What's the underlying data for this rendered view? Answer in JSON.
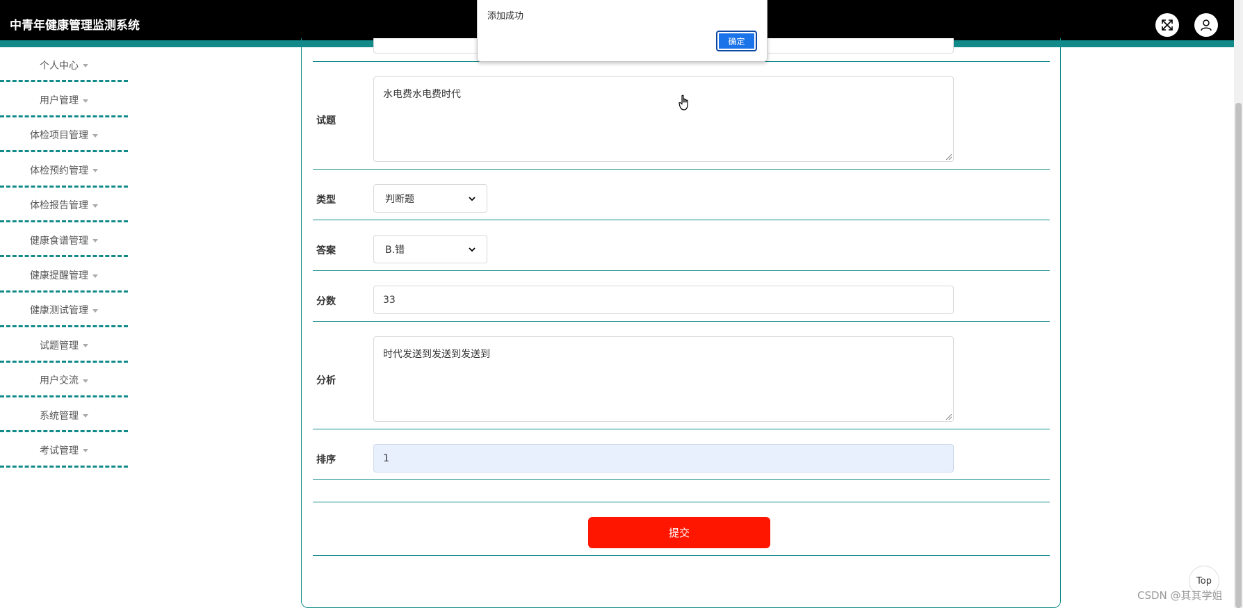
{
  "header": {
    "title": "中青年健康管理监测系统"
  },
  "sidebar": {
    "items": [
      {
        "label": "个人中心"
      },
      {
        "label": "用户管理"
      },
      {
        "label": "体检项目管理"
      },
      {
        "label": "体检预约管理"
      },
      {
        "label": "体检报告管理"
      },
      {
        "label": "健康食谱管理"
      },
      {
        "label": "健康提醒管理"
      },
      {
        "label": "健康测试管理"
      },
      {
        "label": "试题管理"
      },
      {
        "label": "用户交流"
      },
      {
        "label": "系统管理"
      },
      {
        "label": "考试管理"
      }
    ]
  },
  "form": {
    "question": {
      "label": "试题",
      "value": "水电费水电费时代"
    },
    "type": {
      "label": "类型",
      "value": "判断题"
    },
    "answer": {
      "label": "答案",
      "value": "B.错"
    },
    "score": {
      "label": "分数",
      "value": "33"
    },
    "analysis": {
      "label": "分析",
      "value": "时代发送到发送到发送到"
    },
    "order": {
      "label": "排序",
      "value": "1"
    },
    "submit_label": "提交"
  },
  "dialog": {
    "message": "添加成功",
    "ok_label": "确定"
  },
  "top_button": {
    "label": "Top"
  },
  "watermark": {
    "text": "CSDN @其其学姐"
  },
  "colors": {
    "header": "#000000",
    "accent": "#138a8a",
    "submit": "#ff1600",
    "dialog_button": "#1a73e8"
  }
}
